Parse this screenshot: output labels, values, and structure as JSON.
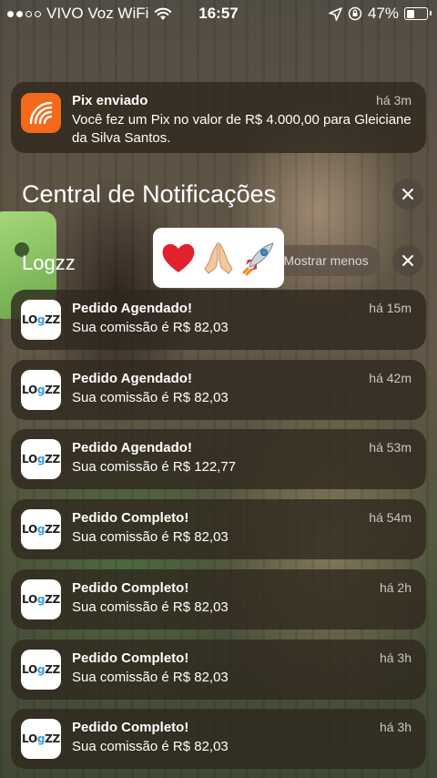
{
  "status_bar": {
    "carrier": "VIVO Voz WiFi",
    "time": "16:57",
    "battery_percent": "47%",
    "battery_level": 0.47,
    "signal_bars_filled": 2,
    "signal_bars_total": 4
  },
  "pix_notification": {
    "app_icon": "pix-icon",
    "title": "Pix enviado",
    "time": "há 3m",
    "body": "Você fez um Pix no valor de R$ 4.000,00 para Gleiciane da Silva Santos."
  },
  "notification_center": {
    "title": "Central de Notificações"
  },
  "group": {
    "app_name": "Logzz",
    "show_less_label": "Mostrar menos"
  },
  "emoji_overlay": [
    "heart",
    "praying-hands",
    "rocket"
  ],
  "logzz_icon": {
    "prefix": "LO",
    "accent": "g",
    "suffix": "ZZ"
  },
  "notifications": [
    {
      "title": "Pedido Agendado!",
      "time": "há 15m",
      "body": "Sua comissão é R$ 82,03"
    },
    {
      "title": "Pedido Agendado!",
      "time": "há 42m",
      "body": "Sua comissão é R$ 82,03"
    },
    {
      "title": "Pedido Agendado!",
      "time": "há 53m",
      "body": "Sua comissão é R$ 122,77"
    },
    {
      "title": "Pedido Completo!",
      "time": "há 54m",
      "body": "Sua comissão é R$ 82,03"
    },
    {
      "title": "Pedido Completo!",
      "time": "há 2h",
      "body": "Sua comissão é R$ 82,03"
    },
    {
      "title": "Pedido Completo!",
      "time": "há 3h",
      "body": "Sua comissão é R$ 82,03"
    },
    {
      "title": "Pedido Completo!",
      "time": "há 3h",
      "body": "Sua comissão é R$ 82,03"
    }
  ],
  "colors": {
    "pix_icon_bg": "#f26a1a",
    "logzz_accent": "#3aa0e0"
  }
}
